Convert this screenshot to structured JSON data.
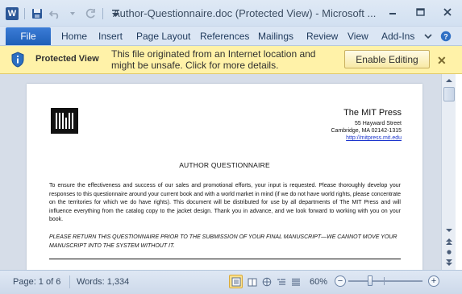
{
  "window": {
    "title": "Author-Questionnaire.doc (Protected View)  -  Microsoft ...",
    "app_icon_letter": "W"
  },
  "ribbon": {
    "file_label": "File",
    "tabs": [
      "Home",
      "Insert",
      "Page Layout",
      "References",
      "Mailings",
      "Review",
      "View",
      "Add-Ins"
    ]
  },
  "message_bar": {
    "title": "Protected View",
    "text": "This file originated from an Internet location and might be unsafe. Click for more details.",
    "button_label": "Enable Editing",
    "close_symbol": "✕",
    "background_color": "#fff2a8"
  },
  "document": {
    "publisher_name": "The MIT Press",
    "address_line1": "55 Hayward Street",
    "address_line2": "Cambridge, MA 02142-1315",
    "url": "http://mitpress.mit.edu",
    "heading": "AUTHOR QUESTIONNAIRE",
    "paragraph": "To ensure the effectiveness and success of our sales and promotional efforts, your input is requested. Please thoroughly develop your responses to this questionnaire around your current book and with a world market in mind (if we do not have world rights, please concentrate on the territories for which we do have rights). This document will be distributed for use by all departments of The MIT Press and will influence everything from the catalog copy to the jacket design. Thank you in advance, and we look forward to working with you on your book.",
    "notice": "PLEASE RETURN THIS QUESTIONNAIRE PRIOR TO THE SUBMISSION OF YOUR FINAL MANUSCRIPT—WE CANNOT MOVE YOUR MANUSCRIPT INTO THE SYSTEM WITHOUT IT."
  },
  "status_bar": {
    "page": "Page: 1 of 6",
    "words": "Words: 1,334",
    "zoom": "60%",
    "zoom_minus": "−",
    "zoom_plus": "+"
  },
  "accent_color": "#2b579a"
}
